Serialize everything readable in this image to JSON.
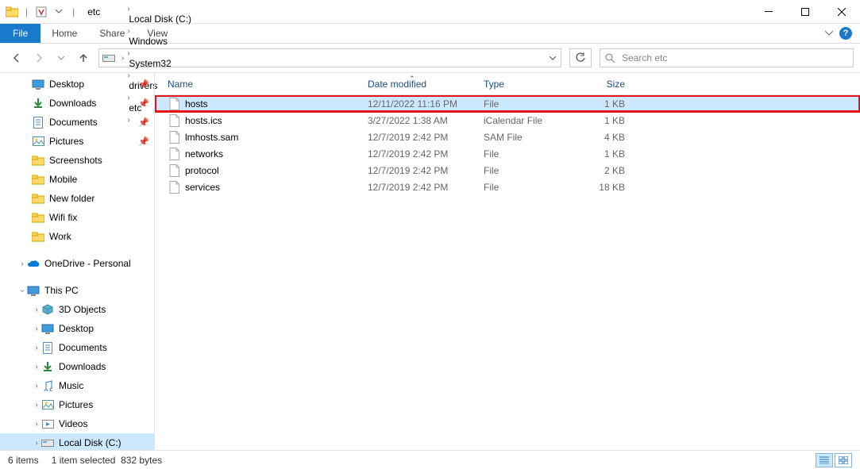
{
  "window": {
    "title": "etc",
    "sep": "|"
  },
  "ribbon": {
    "file": "File",
    "tabs": [
      "Home",
      "Share",
      "View"
    ]
  },
  "breadcrumbs": [
    "This PC",
    "Local Disk (C:)",
    "Windows",
    "System32",
    "drivers",
    "etc"
  ],
  "search": {
    "placeholder": "Search etc"
  },
  "sidebar": {
    "quick": [
      {
        "label": "Desktop",
        "icon": "desktop",
        "pinned": true
      },
      {
        "label": "Downloads",
        "icon": "downloads",
        "pinned": true
      },
      {
        "label": "Documents",
        "icon": "documents",
        "pinned": true
      },
      {
        "label": "Pictures",
        "icon": "pictures",
        "pinned": true
      },
      {
        "label": "Screenshots",
        "icon": "folder"
      },
      {
        "label": "Mobile",
        "icon": "folder"
      },
      {
        "label": "New folder",
        "icon": "folder"
      },
      {
        "label": "Wifi fix",
        "icon": "folder"
      },
      {
        "label": "Work",
        "icon": "folder"
      }
    ],
    "onedrive": {
      "label": "OneDrive - Personal"
    },
    "thispc": {
      "label": "This PC"
    },
    "thispc_children": [
      {
        "label": "3D Objects",
        "icon": "3d"
      },
      {
        "label": "Desktop",
        "icon": "desktop"
      },
      {
        "label": "Documents",
        "icon": "documents"
      },
      {
        "label": "Downloads",
        "icon": "downloads"
      },
      {
        "label": "Music",
        "icon": "music"
      },
      {
        "label": "Pictures",
        "icon": "pictures"
      },
      {
        "label": "Videos",
        "icon": "videos"
      },
      {
        "label": "Local Disk (C:)",
        "icon": "drive",
        "selected": true
      }
    ]
  },
  "columns": {
    "name": "Name",
    "date": "Date modified",
    "type": "Type",
    "size": "Size"
  },
  "files": [
    {
      "name": "hosts",
      "date": "12/11/2022 11:16 PM",
      "type": "File",
      "size": "1 KB",
      "selected": true,
      "highlighted": true
    },
    {
      "name": "hosts.ics",
      "date": "3/27/2022 1:38 AM",
      "type": "iCalendar File",
      "size": "1 KB"
    },
    {
      "name": "lmhosts.sam",
      "date": "12/7/2019 2:42 PM",
      "type": "SAM File",
      "size": "4 KB"
    },
    {
      "name": "networks",
      "date": "12/7/2019 2:42 PM",
      "type": "File",
      "size": "1 KB"
    },
    {
      "name": "protocol",
      "date": "12/7/2019 2:42 PM",
      "type": "File",
      "size": "2 KB"
    },
    {
      "name": "services",
      "date": "12/7/2019 2:42 PM",
      "type": "File",
      "size": "18 KB"
    }
  ],
  "status": {
    "count": "6 items",
    "selection": "1 item selected",
    "bytes": "832 bytes"
  }
}
